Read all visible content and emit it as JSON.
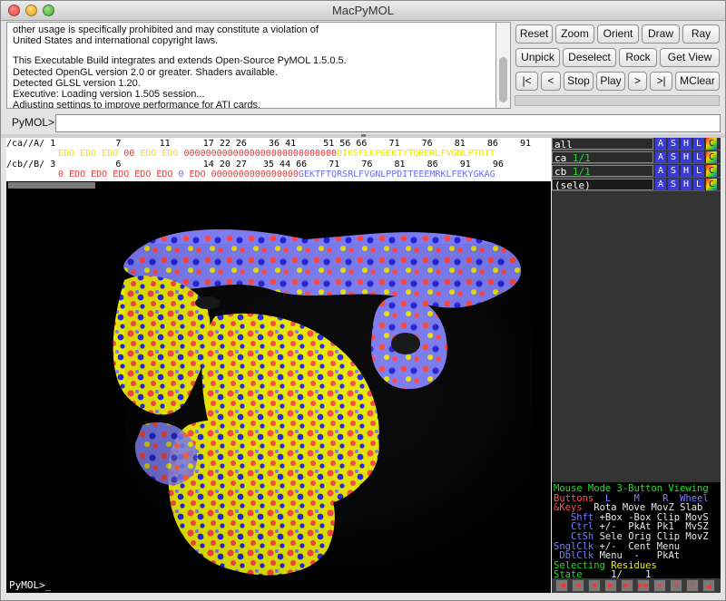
{
  "window": {
    "title": "MacPyMOL"
  },
  "log": {
    "lines": [
      "other usage is specifically prohibited and may constitute a violation of",
      "United States and international copyright laws.",
      "",
      "This Executable Build integrates and extends Open-Source PyMOL 1.5.0.5.",
      "Detected OpenGL version 2.0 or greater. Shaders available.",
      "Detected GLSL version 1.20.",
      "Executive: Loading version 1.505 session...",
      "Adjusting settings to improve performance for ATI cards."
    ]
  },
  "buttons": {
    "row1": [
      "Reset",
      "Zoom",
      "Orient",
      "Draw",
      "Ray"
    ],
    "row2": [
      "Unpick",
      "Deselect",
      "Rock",
      "Get View"
    ],
    "row3": [
      "|<",
      "<",
      "Stop",
      "Play",
      ">",
      ">|",
      "MClear"
    ]
  },
  "command": {
    "label": "PyMOL>",
    "value": ""
  },
  "sequence": {
    "rows": [
      {
        "label": "/ca//A/",
        "numbers": "1           7       11      17 22 26    36 41     51 56 66    71    76    81    86    91",
        "residues_a": "EDO EDO EDO ",
        "residues_b": "00",
        "residues_c": " EDO EDO ",
        "residues_d": "0000000000000000000000000000",
        "residues_e": "DIKSFLKPGEKTYTQRERLFVGNLPTDIT"
      },
      {
        "label": "/cb//B/",
        "numbers": "3           6               14 20 27   35 44 66    71    76    81    86    91    96",
        "residues_a": "0 EDO EDO EDO EDO EDO ",
        "residues_b": "0",
        "residues_c": " EDO ",
        "residues_d": "0000000000000000",
        "residues_e": "GEKTFTQRSRLFVGNLPPDITEEEMRKLFEKYGKAG"
      }
    ]
  },
  "console": {
    "prompt": "PyMOL>_"
  },
  "objects": [
    {
      "name": "all",
      "state": ""
    },
    {
      "name": "ca",
      "state": "1/1"
    },
    {
      "name": "cb",
      "state": "1/1"
    },
    {
      "name": "(sele)",
      "state": ""
    }
  ],
  "object_buttons": [
    "A",
    "S",
    "H",
    "L",
    "C"
  ],
  "mouse": {
    "mode_line": "Mouse Mode 3-Button Viewing",
    "buttons_label": "Buttons",
    "buttons": "L    M    R  Wheel",
    "keys_label": "& Keys",
    "rows": [
      {
        "key": "&Keys",
        "vals": "Rota Move MovZ Slab"
      },
      {
        "key": "Shft",
        "vals": "+Box -Box Clip MovS"
      },
      {
        "key": "Ctrl",
        "vals": "+/-  PkAt Pk1  MvSZ"
      },
      {
        "key": "CtSh",
        "vals": "Sele Orig Clip MovZ"
      },
      {
        "key": "SnglClk",
        "vals": "+/-  Cent Menu"
      },
      {
        "key": "DblClk",
        "vals": "Menu  -   PkAt"
      }
    ],
    "selecting_label": "Selecting",
    "selecting_value": "Residues",
    "state_label": "State",
    "state_value": "1/    1"
  },
  "colors": {
    "yellow": "#e8e800",
    "blue": "#6e6ef0",
    "red": "#ff3030",
    "green": "#20e020"
  }
}
